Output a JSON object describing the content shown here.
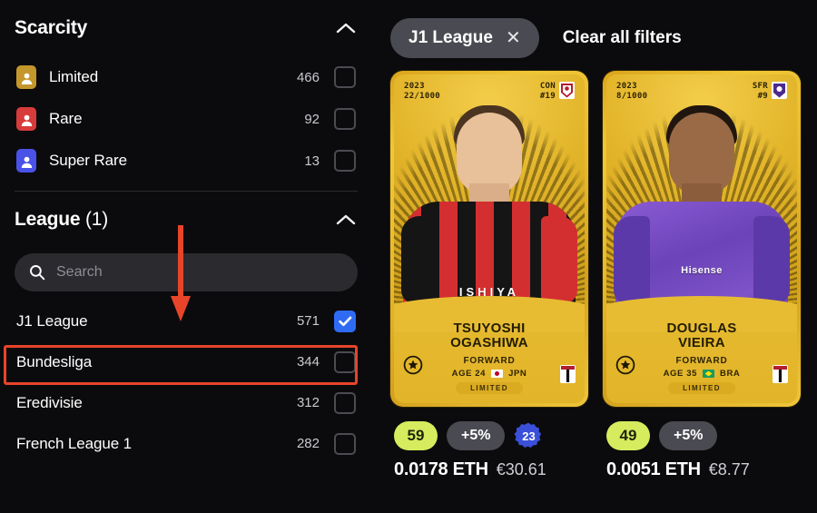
{
  "sidebar": {
    "scarcity": {
      "title": "Scarcity",
      "chevron_icon": "chevron-up-icon",
      "items": [
        {
          "label": "Limited",
          "count": "466",
          "checked": false,
          "color": "#c4962c",
          "icon": "scarcity-limited-icon"
        },
        {
          "label": "Rare",
          "count": "92",
          "checked": false,
          "color": "#d73b3b",
          "icon": "scarcity-rare-icon"
        },
        {
          "label": "Super Rare",
          "count": "13",
          "checked": false,
          "color": "#4a52e8",
          "icon": "scarcity-super-rare-icon"
        }
      ]
    },
    "league": {
      "title": "League",
      "count_suffix": "(1)",
      "chevron_icon": "chevron-up-icon",
      "search": {
        "placeholder": "Search",
        "value": "",
        "icon": "search-icon"
      },
      "items": [
        {
          "label": "J1 League",
          "count": "571",
          "checked": true
        },
        {
          "label": "Bundesliga",
          "count": "344",
          "checked": false
        },
        {
          "label": "Eredivisie",
          "count": "312",
          "checked": false
        },
        {
          "label": "French League 1",
          "count": "282",
          "checked": false
        }
      ]
    }
  },
  "annotation": {
    "arrow_color": "#e8442a",
    "highlight_color": "#e8442a",
    "arrow_icon": "down-arrow-annotation"
  },
  "main": {
    "active_filter_chip": {
      "label": "J1 League",
      "remove_icon": "close-icon"
    },
    "clear_all_label": "Clear all filters",
    "cards": [
      {
        "season": "2023",
        "serial": "22/1000",
        "club_abbr": "CON",
        "shirt_number": "#19",
        "first_name": "TSUYOSHI",
        "last_name": "OGASHIWA",
        "position": "FORWARD",
        "age": "AGE 24",
        "country": "JPN",
        "rarity": "LIMITED",
        "sponsor": "ISHIYA",
        "badges": {
          "score": "59",
          "bonus": "+5%",
          "xp": "23"
        },
        "price_eth": "0.0178 ETH",
        "price_eur": "€30.61",
        "colors": {
          "jersey_a": "#d42f30",
          "jersey_b": "#151515",
          "skin": "#e8c09a",
          "hair": "#4b3521",
          "flag_a": "#ffffff",
          "flag_b": "#bc002d"
        },
        "star_icon": "circled-star-icon",
        "league_icon": "league-crest-icon",
        "club_icon": "club-crest-icon"
      },
      {
        "season": "2023",
        "serial": "8/1000",
        "club_abbr": "SFR",
        "shirt_number": "#9",
        "first_name": "DOUGLAS",
        "last_name": "VIEIRA",
        "position": "FORWARD",
        "age": "AGE 35",
        "country": "BRA",
        "rarity": "LIMITED",
        "sponsor": "Hisense",
        "badges": {
          "score": "49",
          "bonus": "+5%",
          "xp": ""
        },
        "price_eth": "0.0051 ETH",
        "price_eur": "€8.77",
        "colors": {
          "jersey_a": "#7a4fc4",
          "jersey_b": "#5b39a8",
          "skin": "#9a6a47",
          "hair": "#21160f",
          "flag_a": "#169b62",
          "flag_b": "#ffdf00"
        },
        "star_icon": "circled-star-icon",
        "league_icon": "league-crest-icon",
        "club_icon": "club-crest-icon"
      }
    ]
  }
}
